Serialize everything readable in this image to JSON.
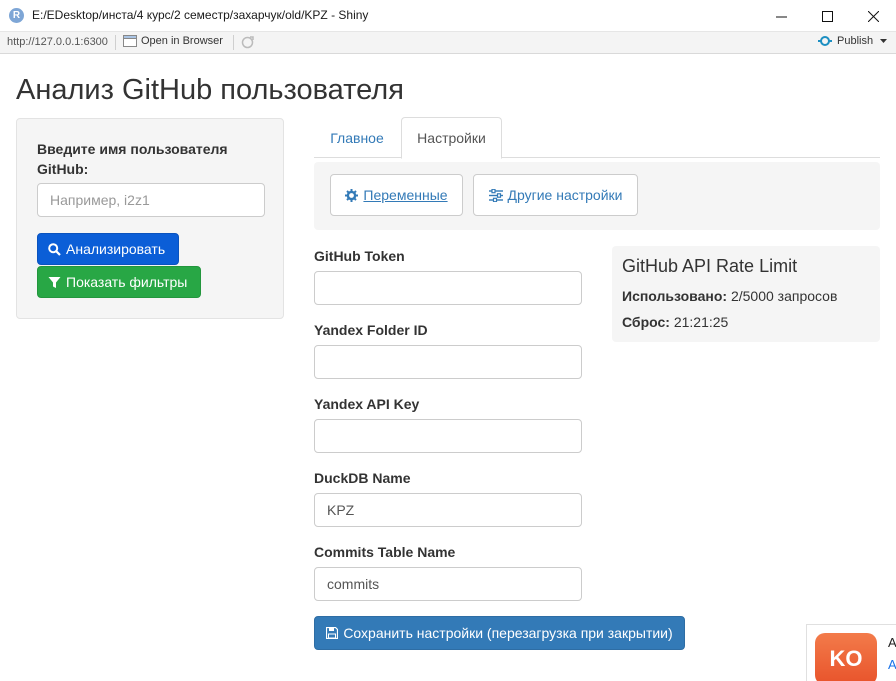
{
  "window": {
    "app_icon_letter": "R",
    "title": "E:/EDesktop/инста/4 курс/2 семестр/захарчук/old/KPZ - Shiny"
  },
  "toolbar": {
    "url": "http://127.0.0.1:6300",
    "open_in_browser": "Open in Browser",
    "publish": "Publish"
  },
  "app": {
    "title": "Анализ GitHub пользователя",
    "sidebar": {
      "label": "Введите имя пользователя GitHub:",
      "placeholder": "Например, i2z1",
      "analyze_button": "Анализировать",
      "filters_button": "Показать фильтры"
    },
    "tabs": [
      {
        "label": "Главное",
        "active": false
      },
      {
        "label": "Настройки",
        "active": true
      }
    ],
    "sub_buttons": {
      "variables": "Переменные",
      "other": "Другие настройки"
    },
    "fields": [
      {
        "label": "GitHub Token",
        "value": ""
      },
      {
        "label": "Yandex Folder ID",
        "value": ""
      },
      {
        "label": "Yandex API Key",
        "value": ""
      },
      {
        "label": "DuckDB Name",
        "value": "KPZ"
      },
      {
        "label": "Commits Table Name",
        "value": "commits"
      }
    ],
    "save_button": "Сохранить настройки (перезагрузка при закрытии)",
    "rate_limit": {
      "title": "GitHub API Rate Limit",
      "used_label": "Использовано:",
      "used_value": "2/5000 запросов",
      "reset_label": "Сброс:",
      "reset_value": "21:21:25"
    }
  },
  "notification": {
    "logo_text": "KO",
    "title_initial": "A",
    "sub_initial": "A"
  },
  "colors": {
    "primary": "#0b5ed7",
    "success": "#28a745",
    "save": "#337ab7",
    "link": "#337ab7"
  }
}
